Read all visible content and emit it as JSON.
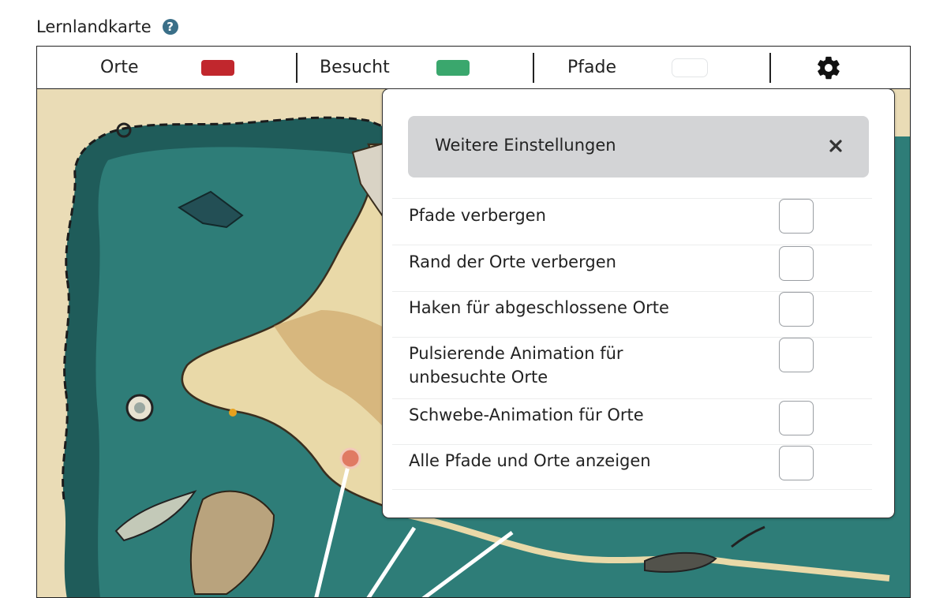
{
  "header": {
    "title": "Lernlandkarte",
    "help_glyph": "?"
  },
  "legend": {
    "items": [
      {
        "label": "Orte",
        "color": "#c1272d"
      },
      {
        "label": "Besucht",
        "color": "#3aa76d"
      },
      {
        "label": "Pfade",
        "color": "#ffffff"
      }
    ],
    "settings_icon": "gear-icon"
  },
  "settings": {
    "title": "Weitere Einstellungen",
    "close_icon": "close-icon",
    "options": [
      {
        "label": "Pfade verbergen",
        "checked": false
      },
      {
        "label": "Rand der Orte verbergen",
        "checked": false
      },
      {
        "label": "Haken für abgeschlossene Orte",
        "checked": false
      },
      {
        "label": "Pulsierende Animation für unbesuchte Orte",
        "checked": false
      },
      {
        "label": "Schwebe-Animation für Orte",
        "checked": false
      },
      {
        "label": "Alle Pfade und Orte anzeigen",
        "checked": false
      }
    ]
  },
  "map": {
    "place_color": "#e07a63",
    "path_color": "#ffffff"
  }
}
